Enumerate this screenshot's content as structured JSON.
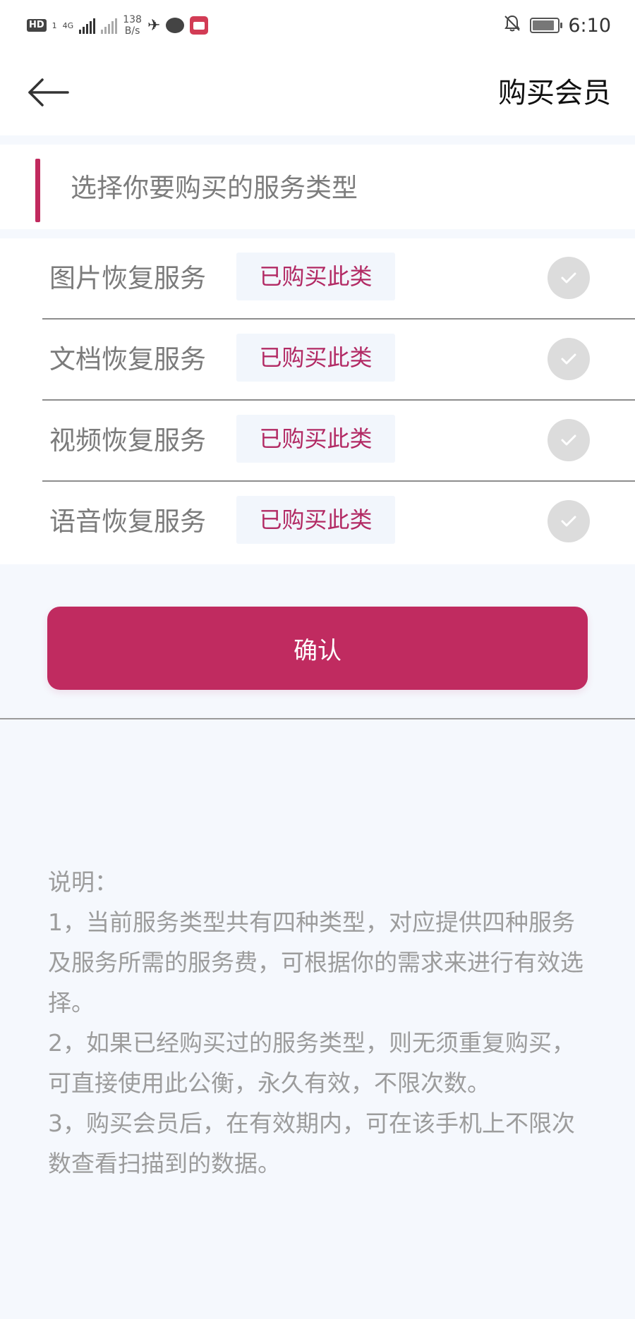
{
  "status_bar": {
    "hd": "HD",
    "sim": "1",
    "network": "4G",
    "speed_value": "138",
    "speed_unit": "B/s",
    "time": "6:10"
  },
  "header": {
    "title": "购买会员"
  },
  "section": {
    "title": "选择你要购买的服务类型"
  },
  "services": [
    {
      "name": "图片恢复服务",
      "badge": "已购买此类"
    },
    {
      "name": "文档恢复服务",
      "badge": "已购买此类"
    },
    {
      "name": "视频恢复服务",
      "badge": "已购买此类"
    },
    {
      "name": "语音恢复服务",
      "badge": "已购买此类"
    }
  ],
  "confirm": {
    "label": "确认"
  },
  "notes": {
    "title": "说明：",
    "lines": [
      "1，当前服务类型共有四种类型，对应提供四种服务及服务所需的服务费，可根据你的需求来进行有效选择。",
      "2，如果已经购买过的服务类型，则无须重复购买，可直接使用此公衡，永久有效，不限次数。",
      "3，购买会员后，在有效期内，可在该手机上不限次数查看扫描到的数据。"
    ]
  },
  "colors": {
    "accent": "#c02b60",
    "badge_text": "#b22a64",
    "badge_bg": "#f2f6fc",
    "page_bg": "#f5f8fd"
  }
}
